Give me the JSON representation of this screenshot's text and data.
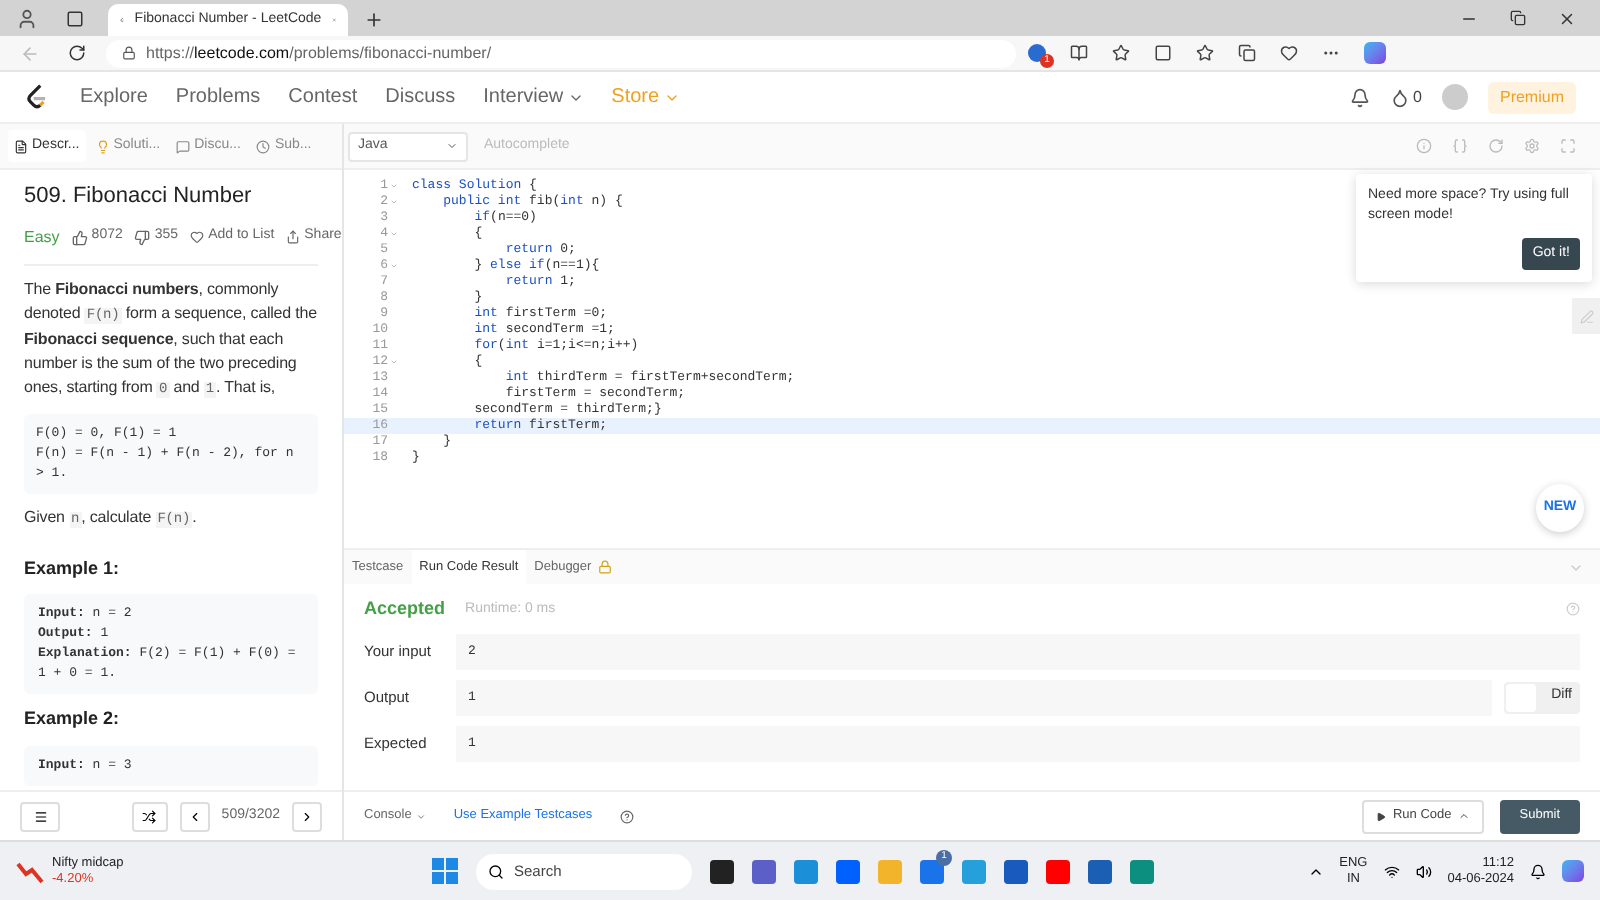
{
  "browser": {
    "tab_title": "Fibonacci Number - LeetCode",
    "url_prefix": "https://",
    "url_domain": "leetcode.com",
    "url_path": "/problems/fibonacci-number/",
    "notification_count": "1"
  },
  "nav": {
    "links": [
      {
        "label": "Explore",
        "kind": "link"
      },
      {
        "label": "Problems",
        "kind": "link"
      },
      {
        "label": "Contest",
        "kind": "link"
      },
      {
        "label": "Discuss",
        "kind": "link"
      },
      {
        "label": "Interview",
        "kind": "menu"
      },
      {
        "label": "Store",
        "kind": "store"
      }
    ],
    "coins": "0",
    "premium": "Premium"
  },
  "panel_tabs": [
    {
      "label": "Descr...",
      "selected": true
    },
    {
      "label": "Soluti...",
      "selected": false
    },
    {
      "label": "Discu...",
      "selected": false
    },
    {
      "label": "Sub...",
      "selected": false
    }
  ],
  "problem": {
    "title": "509. Fibonacci Number",
    "difficulty": "Easy",
    "likes": "8072",
    "dislikes": "355",
    "add_to_list": "Add to List",
    "share": "Share",
    "description": [
      {
        "kind": "text",
        "text": "The "
      },
      {
        "kind": "bold",
        "text": "Fibonacci numbers"
      },
      {
        "kind": "text",
        "text": ", commonly denoted "
      },
      {
        "kind": "code",
        "text": "F(n)"
      },
      {
        "kind": "text",
        "text": " form a sequence, called the "
      },
      {
        "kind": "bold",
        "text": "Fibonacci sequence"
      },
      {
        "kind": "text",
        "text": ", such that each number is the sum of the two preceding ones, starting from "
      },
      {
        "kind": "code",
        "text": "0"
      },
      {
        "kind": "text",
        "text": " and "
      },
      {
        "kind": "code",
        "text": "1"
      },
      {
        "kind": "text",
        "text": ". That is,"
      }
    ],
    "formula": [
      "F(0) = 0, F(1) = 1",
      "F(n) = F(n - 1) + F(n - 2), for n > 1."
    ],
    "given": [
      {
        "kind": "text",
        "text": "Given "
      },
      {
        "kind": "code",
        "text": "n"
      },
      {
        "kind": "text",
        "text": ", calculate "
      },
      {
        "kind": "code",
        "text": "F(n)"
      },
      {
        "kind": "text",
        "text": "."
      }
    ],
    "examples": [
      {
        "title": "Example 1:",
        "lines": [
          {
            "label": "Input:",
            "value": " n = 2"
          },
          {
            "label": "Output:",
            "value": " 1"
          },
          {
            "label": "Explanation:",
            "value": " F(2) = F(1) + F(0) = 1 + 0 = 1."
          }
        ]
      },
      {
        "title": "Example 2:",
        "lines": [
          {
            "label": "Input:",
            "value": " n = 3"
          }
        ]
      }
    ]
  },
  "pager": "509/3202",
  "editor": {
    "language": "Java",
    "autocomplete": "Autocomplete",
    "lines": [
      {
        "number": "1",
        "fold": true,
        "code": "class Solution {"
      },
      {
        "number": "2",
        "fold": true,
        "code": "    public int fib(int n) {"
      },
      {
        "number": "3",
        "fold": false,
        "code": "        if(n==0)"
      },
      {
        "number": "4",
        "fold": true,
        "code": "        {"
      },
      {
        "number": "5",
        "fold": false,
        "code": "            return 0;"
      },
      {
        "number": "6",
        "fold": true,
        "code": "        } else if(n==1){"
      },
      {
        "number": "7",
        "fold": false,
        "code": "            return 1;"
      },
      {
        "number": "8",
        "fold": false,
        "code": "        }"
      },
      {
        "number": "9",
        "fold": false,
        "code": "        int firstTerm =0;"
      },
      {
        "number": "10",
        "fold": false,
        "code": "        int secondTerm =1;"
      },
      {
        "number": "11",
        "fold": false,
        "code": "        for(int i=1;i<=n;i++)"
      },
      {
        "number": "12",
        "fold": true,
        "code": "        {"
      },
      {
        "number": "13",
        "fold": false,
        "code": "            int thirdTerm = firstTerm+secondTerm;"
      },
      {
        "number": "14",
        "fold": false,
        "code": "            firstTerm = secondTerm;"
      },
      {
        "number": "15",
        "fold": false,
        "code": "        secondTerm = thirdTerm;}"
      },
      {
        "number": "16",
        "fold": false,
        "highlighted": true,
        "code": "        return firstTerm;"
      },
      {
        "number": "17",
        "fold": false,
        "code": "    }"
      },
      {
        "number": "18",
        "fold": false,
        "code": "}"
      }
    ],
    "tip": {
      "text": "Need more space? Try using full screen mode!",
      "button": "Got it!"
    },
    "new_badge": "NEW"
  },
  "result_tabs": [
    {
      "label": "Testcase",
      "selected": false
    },
    {
      "label": "Run Code Result",
      "selected": true
    },
    {
      "label": "Debugger",
      "selected": false
    }
  ],
  "result": {
    "status": "Accepted",
    "runtime": "Runtime: 0 ms",
    "rows": [
      {
        "label": "Your input",
        "value": "2"
      },
      {
        "label": "Output",
        "value": "1"
      },
      {
        "label": "Expected",
        "value": "1"
      }
    ],
    "diff": "Diff"
  },
  "footer": {
    "console": "Console",
    "example": "Use Example Testcases",
    "run": "Run Code",
    "submit": "Submit"
  },
  "taskbar": {
    "widget_title": "Nifty midcap",
    "widget_value": "-4.20%",
    "search": "Search",
    "mail_badge": "1",
    "lang": "ENG",
    "region": "IN",
    "time": "11:12",
    "date": "04-06-2024"
  }
}
